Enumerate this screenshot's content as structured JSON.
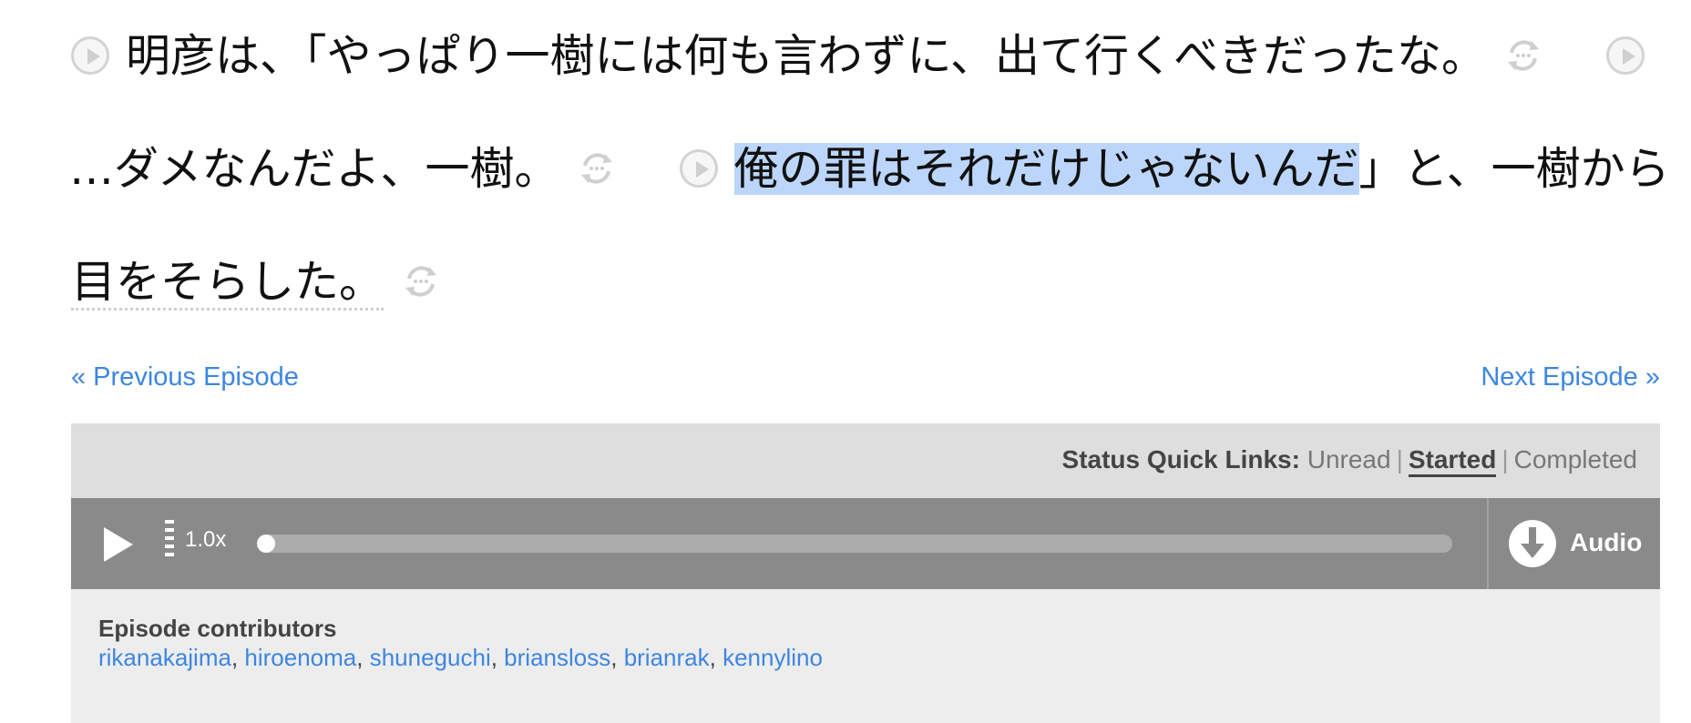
{
  "story": {
    "line1": {
      "text": "明彦は、「やっぱり一樹には何も言わずに、出て行くべきだったな。"
    },
    "line2": {
      "text_a": "…ダメなんだよ、一樹。",
      "text_highlight": "俺の罪はそれだけじゃないんだ",
      "text_b": "」と、一樹から"
    },
    "line3": {
      "text": "目をそらした。"
    }
  },
  "nav": {
    "prev": "« Previous Episode",
    "next": "Next Episode »"
  },
  "status": {
    "label": "Status Quick Links:",
    "unread": "Unread",
    "sep": "|",
    "started": "Started",
    "completed": "Completed"
  },
  "player": {
    "speed": "1.0x",
    "progress": 0,
    "audio_label": "Audio"
  },
  "contributors": {
    "title": "Episode contributors",
    "names": [
      "rikanakajima",
      "hiroenoma",
      "shuneguchi",
      "briansloss",
      "brianrak",
      "kennylino"
    ],
    "separator": ", "
  },
  "colors": {
    "link": "#3d86e0",
    "highlight": "#bcd6fb",
    "player_bg": "#8a8a8a"
  },
  "icons": {
    "sentence_play": "play-circle-icon",
    "sentence_loop": "loop-icon",
    "player_play": "play-icon",
    "speed": "speed-icon",
    "download": "download-icon"
  }
}
